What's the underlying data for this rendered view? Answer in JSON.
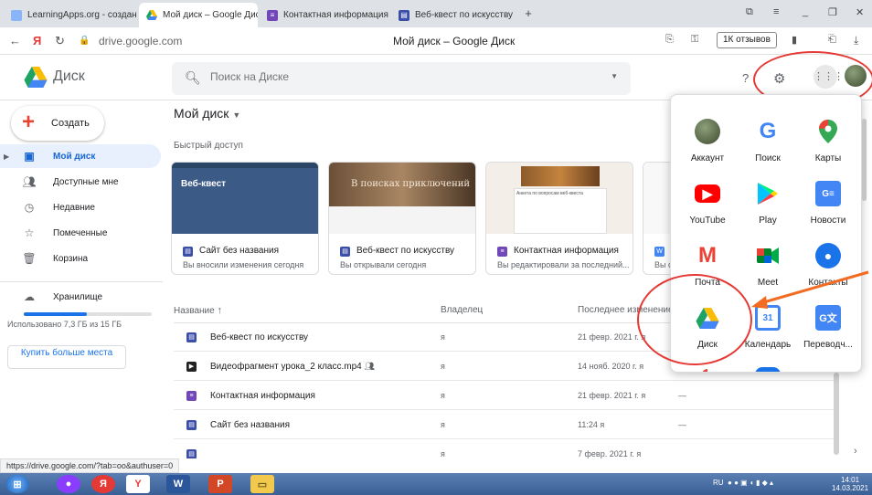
{
  "browser": {
    "tabs": [
      {
        "label": "LearningApps.org - создан",
        "active": false
      },
      {
        "label": "Мой диск – Google Дис",
        "active": true
      },
      {
        "label": "Контактная информация",
        "active": false
      },
      {
        "label": "Веб-квест по искусству",
        "active": false
      }
    ],
    "url": "drive.google.com",
    "page_title": "Мой диск – Google Диск",
    "reviews_label": "1К отзывов"
  },
  "drive": {
    "logo_text": "Диск",
    "search_placeholder": "Поиск на Диске",
    "new_button": "Создать",
    "nav": [
      {
        "label": "Мой диск",
        "icon": "my-drive-icon"
      },
      {
        "label": "Доступные мне",
        "icon": "shared-icon"
      },
      {
        "label": "Недавние",
        "icon": "clock-icon"
      },
      {
        "label": "Помеченные",
        "icon": "star-icon"
      },
      {
        "label": "Корзина",
        "icon": "trash-icon"
      }
    ],
    "storage_label": "Хранилище",
    "storage_used": "Использовано 7,3 ГБ из 15 ГБ",
    "storage_fraction": 0.49,
    "buy_more": "Купить больше места",
    "main_title": "Мой диск",
    "quick_access": "Быстрый доступ",
    "cards": [
      {
        "name": "Сайт без названия",
        "sub": "Вы вносили изменения сегодня",
        "thumb_text": "Веб-квест",
        "type": "sites"
      },
      {
        "name": "Веб-квест по искусству",
        "sub": "Вы открывали сегодня",
        "thumb_text": "В поисках приключений",
        "type": "sites"
      },
      {
        "name": "Контактная информация",
        "sub": "Вы редактировали за последний...",
        "thumb_text": "Анкета по вопросам веб-квеста",
        "type": "forms"
      },
      {
        "name": "",
        "sub": "Вы о",
        "thumb_text": "",
        "type": "docs"
      }
    ],
    "columns": {
      "name": "Название",
      "owner": "Владелец",
      "modified": "Последнее изменение"
    },
    "files": [
      {
        "name": "Веб-квест по искусству",
        "owner": "я",
        "date": "21 февр. 2021 г. я",
        "size": "—",
        "type": "sites"
      },
      {
        "name": "Видеофрагмент урока_2 класс.mp4",
        "owner": "я",
        "date": "14 нояб. 2020 г. я",
        "size": "—",
        "type": "video"
      },
      {
        "name": "Контактная информация",
        "owner": "я",
        "date": "21 февр. 2021 г. я",
        "size": "—",
        "type": "forms"
      },
      {
        "name": "Сайт без названия",
        "owner": "я",
        "date": "11:24 я",
        "size": "—",
        "type": "sites"
      },
      {
        "name": "",
        "owner": "я",
        "date": "7 февр. 2021 г. я",
        "size": "",
        "type": "sites"
      }
    ]
  },
  "apps": [
    {
      "label": "Аккаунт",
      "icon": "account-icon",
      "color": "#6d7a5a"
    },
    {
      "label": "Поиск",
      "icon": "google-search-icon",
      "color": "#4285f4"
    },
    {
      "label": "Карты",
      "icon": "maps-icon",
      "color": "#34a853"
    },
    {
      "label": "YouTube",
      "icon": "youtube-icon",
      "color": "#ff0000"
    },
    {
      "label": "Play",
      "icon": "play-icon",
      "color": "#00a173"
    },
    {
      "label": "Новости",
      "icon": "news-icon",
      "color": "#4285f4"
    },
    {
      "label": "Почта",
      "icon": "gmail-icon",
      "color": "#ea4335"
    },
    {
      "label": "Meet",
      "icon": "meet-icon",
      "color": "#00897b"
    },
    {
      "label": "Контакты",
      "icon": "contacts-icon",
      "color": "#1a73e8"
    },
    {
      "label": "Диск",
      "icon": "drive-icon",
      "color": "#fbbc04"
    },
    {
      "label": "Календарь",
      "icon": "calendar-icon",
      "color": "#4285f4"
    },
    {
      "label": "Переводч...",
      "icon": "translate-icon",
      "color": "#4285f4"
    }
  ],
  "status_url": "https://drive.google.com/?tab=oo&authuser=0",
  "taskbar": {
    "lang": "RU",
    "time": "14:01",
    "date": "14.03.2021"
  }
}
